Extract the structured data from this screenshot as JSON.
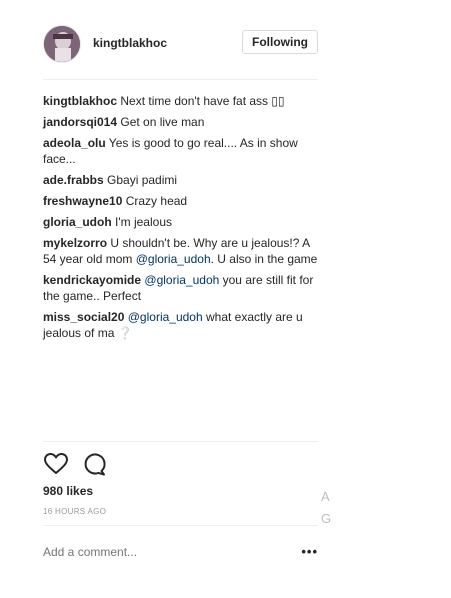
{
  "header": {
    "username": "kingtblakhoc",
    "follow_label": "Following"
  },
  "comments": [
    {
      "user": "kingtblakhoc",
      "text": " Next time don't have fat ass ▯▯"
    },
    {
      "user": "jandorsqi014",
      "text": " Get on live man"
    },
    {
      "user": "adeola_olu",
      "text": " Yes is good to go real.... As in show face..."
    },
    {
      "user": "ade.frabbs",
      "text": " Gbayi padimi"
    },
    {
      "user": "freshwayne10",
      "text": " Crazy head"
    },
    {
      "user": "gloria_udoh",
      "text": " I'm jealous"
    },
    {
      "user": "mykelzorro",
      "text_before": " U shouldn't be. Why are u jealous!? A 54 year old mom ",
      "mention": "@gloria_udoh",
      "text_after": ". U also in the game"
    },
    {
      "user": "kendrickayomide",
      "text_before": " ",
      "mention": "@gloria_udoh",
      "text_after": " you are still fit for the game.. Perfect"
    },
    {
      "user": "miss_social20",
      "text_before": " ",
      "mention": "@gloria_udoh",
      "text_after": " what exactly are u jealous of ma ❔"
    }
  ],
  "footer": {
    "likes": "980 likes",
    "time": "16 HOURS AGO",
    "add_comment_placeholder": "Add a comment...",
    "more": "•••"
  },
  "side": {
    "line1": "A",
    "line2": "G"
  },
  "icons": {
    "like": "heart-icon",
    "comment": "comment-bubble-icon",
    "more": "more-options-icon"
  },
  "colors": {
    "mention": "#003569",
    "text": "#262626",
    "muted": "#999999",
    "border": "#dbdbdb"
  }
}
